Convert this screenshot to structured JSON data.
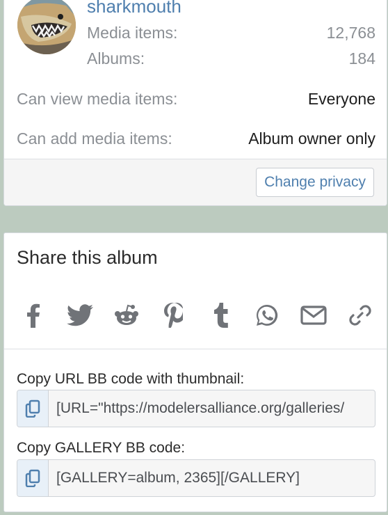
{
  "owner": {
    "username": "sharkmouth",
    "stats": [
      {
        "label": "Media items:",
        "value": "12,768"
      },
      {
        "label": "Albums:",
        "value": "184"
      }
    ]
  },
  "privacy": {
    "rows": [
      {
        "label": "Can view media items:",
        "value": "Everyone"
      },
      {
        "label": "Can add media items:",
        "value": "Album owner only"
      }
    ],
    "change_button": "Change privacy"
  },
  "share": {
    "title": "Share this album",
    "icons": [
      "facebook-icon",
      "twitter-icon",
      "reddit-icon",
      "pinterest-icon",
      "tumblr-icon",
      "whatsapp-icon",
      "email-icon",
      "link-icon"
    ],
    "copy_fields": [
      {
        "label": "Copy URL BB code with thumbnail:",
        "value": "[URL=\"https://modelersalliance.org/galleries/"
      },
      {
        "label": "Copy GALLERY BB code:",
        "value": "[GALLERY=album, 2365][/GALLERY]"
      }
    ]
  },
  "colors": {
    "page_bg": "#bccbbf",
    "link": "#4f7fae",
    "muted": "#8b8f94",
    "icon": "#707378"
  }
}
